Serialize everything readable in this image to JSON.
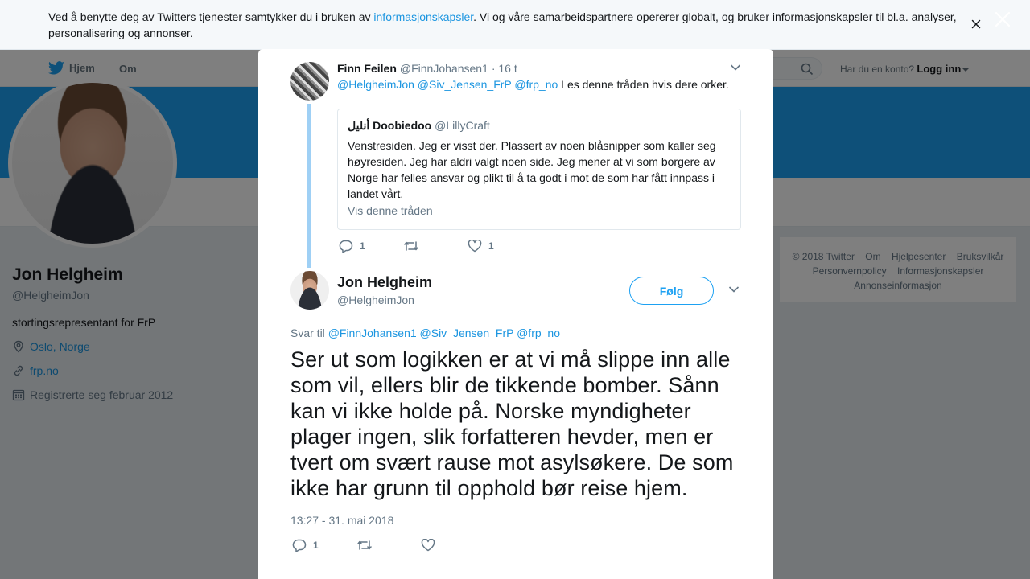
{
  "cookie": {
    "text_before": "Ved å benytte deg av Twitters tjenester samtykker du i bruken av ",
    "link": "informasjonskapsler",
    "text_after": ". Vi og våre samarbeidspartnere opererer globalt, og bruker informasjonskapsler til bl.a. analyser, personalisering og annonser."
  },
  "nav": {
    "home": "Hjem",
    "about": "Om",
    "account_prompt": "Har du en konto?",
    "login": "Logg inn"
  },
  "profile": {
    "name": "Jon Helgheim",
    "handle": "@HelgheimJon",
    "bio": "stortingsrepresentant for FrP",
    "location": "Oslo, Norge",
    "website": "frp.no",
    "joined": "Registrerte seg februar 2012"
  },
  "footer": {
    "links": [
      "© 2018 Twitter",
      "Om",
      "Hjelpesenter",
      "Bruksvilkår",
      "Personvernpolicy",
      "Informasjonskapsler",
      "Annonseinformasjon"
    ]
  },
  "ancestor": {
    "name": "Finn Feilen",
    "handle": "@FinnJohansen1",
    "time": "· 16 t",
    "mentions": "@HelgheimJon @Siv_Jensen_FrP @frp_no",
    "text": " Les denne tråden hvis dere orker.",
    "reply_count": "1",
    "retweet_count": "",
    "like_count": "1",
    "quote": {
      "name": "أنليل Doobiedoo",
      "handle": "@LillyCraft",
      "text": "Venstresiden. Jeg er visst der. Plassert av noen blåsnipper som kaller seg høyresiden. Jeg har aldri valgt noen side. Jeg mener at vi som borgere av Norge har felles ansvar og plikt til å ta godt i mot de som har fått innpass i landet vårt.",
      "more": "Vis denne tråden"
    }
  },
  "main_tweet": {
    "name": "Jon Helgheim",
    "handle": "@HelgheimJon",
    "follow": "Følg",
    "reply_label": "Svar til",
    "reply_mentions": "@FinnJohansen1 @Siv_Jensen_FrP @frp_no",
    "text": "Ser ut som logikken er at vi må slippe inn alle som vil, ellers blir de tikkende bomber. Sånn kan vi ikke holde på. Norske myndigheter plager ingen, slik forfatteren hevder, men er tvert om svært rause mot asylsøkere. De som ikke har grunn til opphold bør reise hjem.",
    "timestamp": "13:27 - 31. mai 2018",
    "reply_count": "1",
    "retweet_count": "",
    "like_count": ""
  },
  "colors": {
    "accent": "#1da1f2",
    "link": "#1b95e0",
    "muted": "#657786"
  }
}
